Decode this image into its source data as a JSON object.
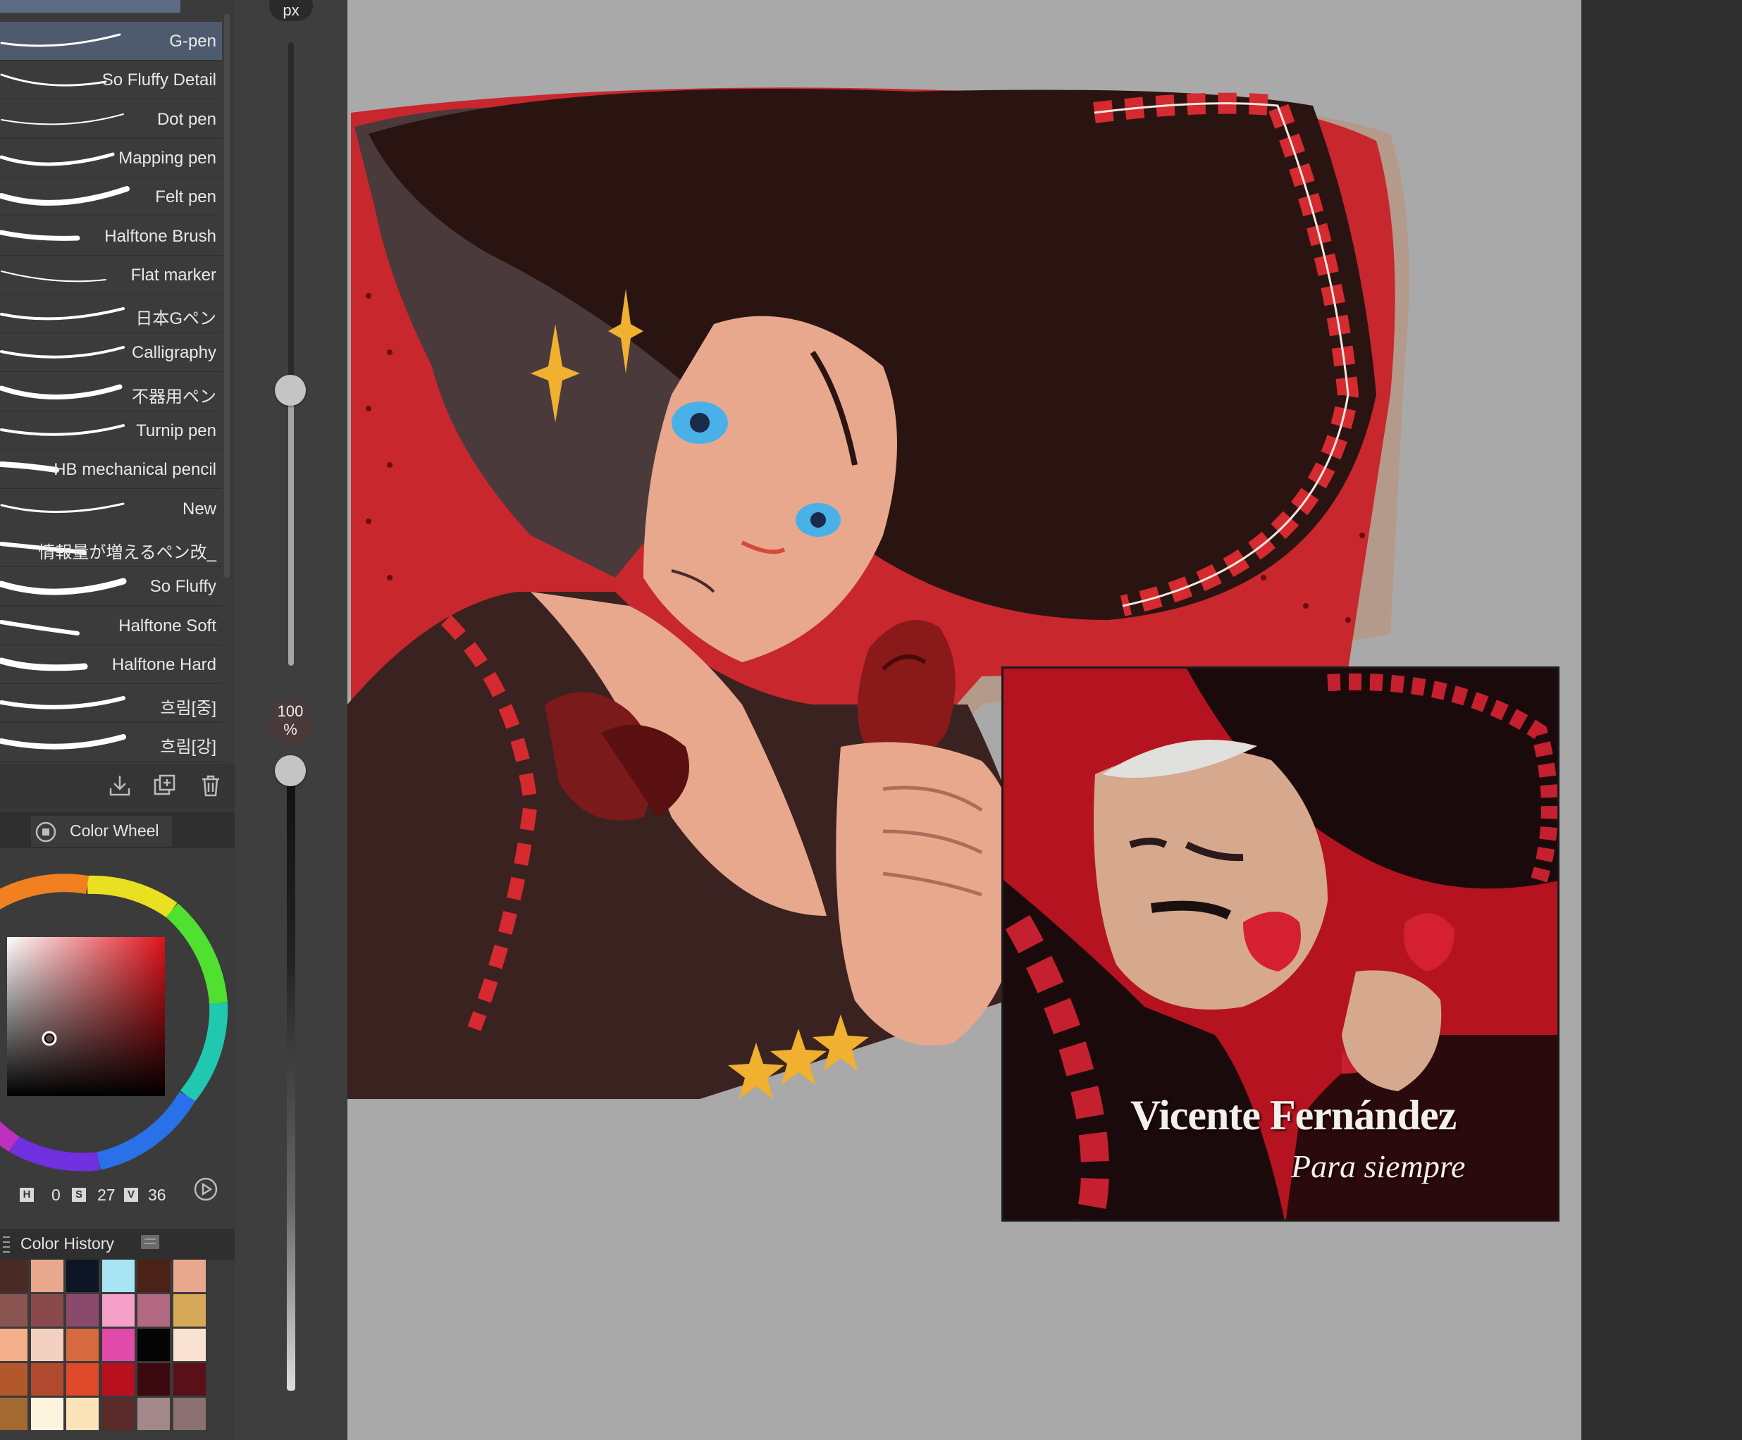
{
  "brush_panel": {
    "items": [
      {
        "label": "G-pen",
        "selected": true
      },
      {
        "label": "So Fluffy Detail"
      },
      {
        "label": "Dot pen"
      },
      {
        "label": "Mapping pen"
      },
      {
        "label": "Felt pen"
      },
      {
        "label": "Halftone Brush"
      },
      {
        "label": "Flat marker"
      },
      {
        "label": "日本Gペン"
      },
      {
        "label": "Calligraphy"
      },
      {
        "label": "不器用ペン"
      },
      {
        "label": "Turnip pen"
      },
      {
        "label": "HB mechanical pencil"
      },
      {
        "label": "New"
      },
      {
        "label": "情報量が増えるペン改_"
      },
      {
        "label": "So Fluffy"
      },
      {
        "label": "Halftone Soft"
      },
      {
        "label": "Halftone Hard"
      },
      {
        "label": "흐림[중]"
      },
      {
        "label": "흐림[강]"
      }
    ],
    "toolbar_icons": [
      "import-icon",
      "duplicate-icon",
      "trash-icon"
    ]
  },
  "color_wheel": {
    "tab_label": "Color Wheel",
    "h_label": "H",
    "h_value": "0",
    "s_label": "S",
    "s_value": "27",
    "v_label": "V",
    "v_value": "36"
  },
  "color_history": {
    "tab_label": "Color History",
    "swatches": [
      "#4a2a24",
      "#e8a88e",
      "#0e1626",
      "#a8e4f4",
      "#4a2218",
      "#e8a88e",
      "#8a5450",
      "#8a4a4c",
      "#8a4a6c",
      "#f4a0c8",
      "#b26880",
      "#d6a85a",
      "#f4b08a",
      "#f4d0c0",
      "#d46a3e",
      "#e04aa8",
      "#050505",
      "#fae2d2",
      "#b2582a",
      "#b24a30",
      "#e04a2a",
      "#b8101e",
      "#3a0a10",
      "#5a1018",
      "#a26a30",
      "#fef4de",
      "#fae4b8",
      "#5a2a2a",
      "#a28888",
      "#8a7070"
    ]
  },
  "tool_property": {
    "unit_label": "px",
    "opacity_value": "100",
    "opacity_unit": "%",
    "size_level": 0.44,
    "opacity_level": 1.0
  },
  "reference_photo": {
    "title": "Vicente Fernández",
    "subtitle": "Para siempre"
  },
  "colors": {
    "canvas_bg": "#a9a9a9",
    "art_red": "#c8272e",
    "hat_dark": "#2a1412",
    "ui_dark": "#323232"
  }
}
